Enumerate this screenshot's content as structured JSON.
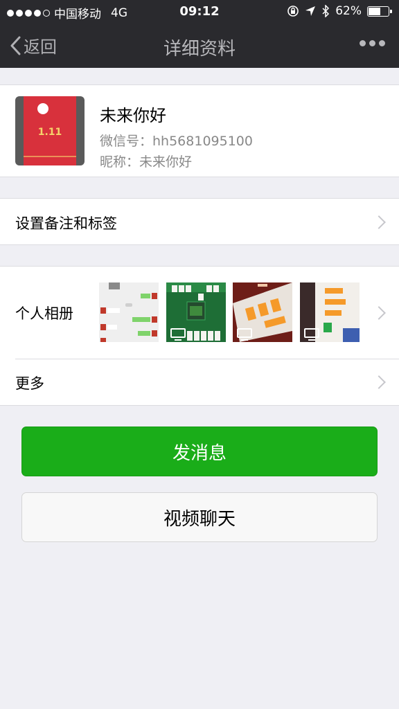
{
  "status_bar": {
    "carrier": "中国移动",
    "network": "4G",
    "time": "09:12",
    "battery": "62%",
    "battery_level": 0.62
  },
  "nav": {
    "back_label": "返回",
    "title": "详细资料"
  },
  "profile": {
    "name": "未来你好",
    "wechat_id": "微信号：hh5681095100",
    "nickname": "昵称：未来你好",
    "avatar_amount": "1.11"
  },
  "rows": {
    "remark_label": "设置备注和标签",
    "album_label": "个人相册",
    "more_label": "更多"
  },
  "album": {
    "photos": [
      {
        "name": "chat-screenshot",
        "video": false
      },
      {
        "name": "mahjong-game",
        "video": true
      },
      {
        "name": "orange-cards-game",
        "video": true
      },
      {
        "name": "phone-screen-game",
        "video": true
      }
    ]
  },
  "actions": {
    "send_message": "发消息",
    "video_chat": "视频聊天"
  },
  "colors": {
    "nav_bg": "#2a2a2e",
    "primary_green": "#1aad19",
    "page_bg": "#efeff4"
  }
}
